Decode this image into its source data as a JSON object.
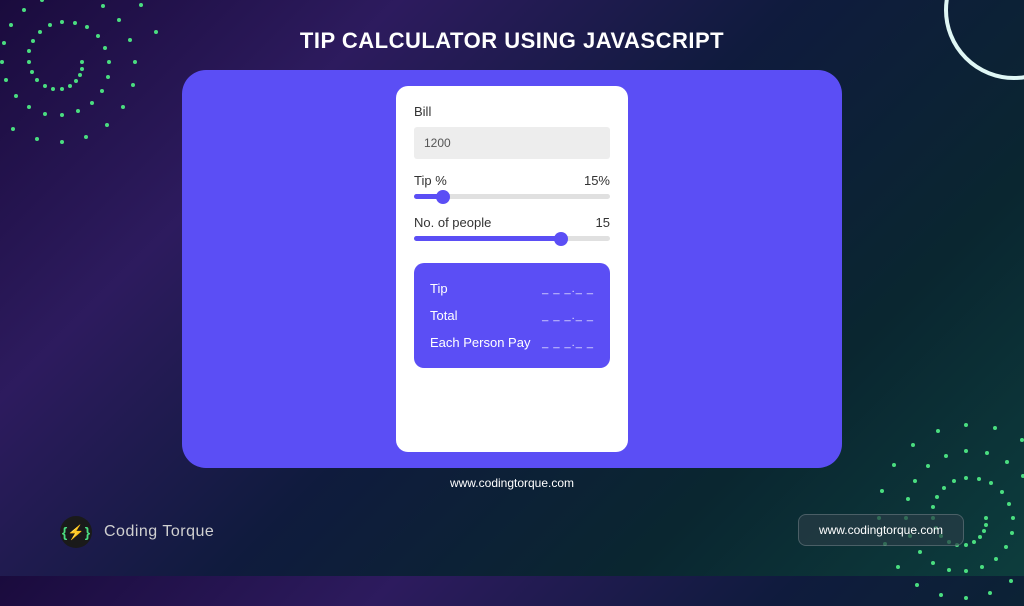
{
  "title": "TIP CALCULATOR USING JAVASCRIPT",
  "calculator": {
    "bill_label": "Bill",
    "bill_value": "1200",
    "tip_label": "Tip %",
    "tip_value": "15%",
    "tip_percent": 15,
    "people_label": "No. of people",
    "people_value": "15",
    "people_percent": 75,
    "results": {
      "tip_label": "Tip",
      "tip_value": "_ _ _._ _",
      "total_label": "Total",
      "total_value": "_ _ _._ _",
      "each_label": "Each Person Pay",
      "each_value": "_ _ _._ _"
    }
  },
  "url_below": "www.codingtorque.com",
  "brand": {
    "logo_text": "{⚡}",
    "name": "Coding Torque"
  },
  "footer_link": "www.codingtorque.com"
}
